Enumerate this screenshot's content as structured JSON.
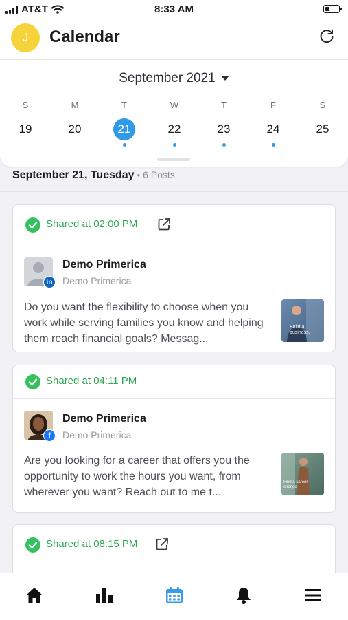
{
  "status": {
    "carrier": "AT&T",
    "time": "8:33 AM",
    "battery_level": 0.35
  },
  "header": {
    "avatar_initial": "J",
    "title": "Calendar"
  },
  "calendar": {
    "month": "September 2021",
    "days": [
      {
        "letter": "S",
        "num": "19",
        "dot": false
      },
      {
        "letter": "M",
        "num": "20",
        "dot": false
      },
      {
        "letter": "T",
        "num": "21",
        "dot": true,
        "selected": true
      },
      {
        "letter": "W",
        "num": "22",
        "dot": true
      },
      {
        "letter": "T",
        "num": "23",
        "dot": true
      },
      {
        "letter": "F",
        "num": "24",
        "dot": true
      },
      {
        "letter": "S",
        "num": "25",
        "dot": false
      }
    ],
    "accent": "#2f9ae8"
  },
  "date_header": {
    "date": "September 21, Tuesday",
    "separator": "•",
    "count": "6 Posts"
  },
  "posts": [
    {
      "shared": "Shared at 02:00 PM",
      "name": "Demo Primerica",
      "sub": "Demo Primerica",
      "network": "linkedin",
      "text": "Do you want the flexibility to choose when you work while serving families you know and helping them reach financial goals? Messag...",
      "thumb_caption": "Build a business."
    },
    {
      "shared": "Shared at 04:11 PM",
      "name": "Demo Primerica",
      "sub": "Demo Primerica",
      "network": "facebook",
      "text": "Are you looking for a career that offers you the opportunity to work the hours you want, from wherever you want? Reach out to me t...",
      "thumb_caption": "Find a career change"
    },
    {
      "shared": "Shared at 08:15 PM"
    }
  ],
  "tabs": [
    "home-icon",
    "analytics-icon",
    "calendar-icon",
    "notifications-icon",
    "menu-icon"
  ],
  "colors": {
    "success": "#2ea653",
    "accent": "#2f9ae8",
    "linkedin": "#0a66c2",
    "facebook": "#1877f2"
  }
}
